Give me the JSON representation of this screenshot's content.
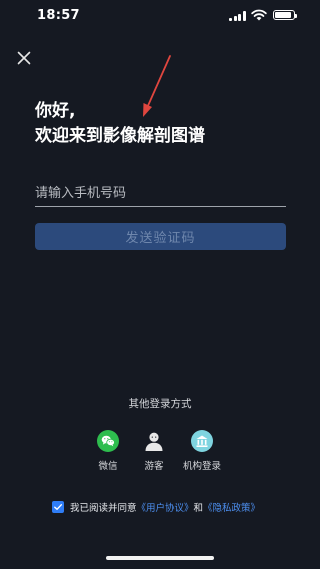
{
  "status_bar": {
    "time": "18:57",
    "signal_icon": "signal-bars-icon",
    "wifi_icon": "wifi-icon",
    "battery_icon": "battery-icon",
    "battery_level": 0.9
  },
  "header": {
    "close_icon": "close-icon"
  },
  "annotation": {
    "arrow_icon": "red-arrow-icon",
    "arrow_color": "#e0463f"
  },
  "greeting": {
    "line1": "你好,",
    "line2": "欢迎来到影像解剖图谱"
  },
  "phone_input": {
    "value": "",
    "placeholder": "请输入手机号码"
  },
  "send_code_button": {
    "label": "发送验证码",
    "background": "#2c4a7c",
    "text_color": "#6f87ad"
  },
  "other_login": {
    "title": "其他登录方式",
    "options": [
      {
        "label": "微信",
        "icon": "wechat-icon",
        "color": "#2ebd4e"
      },
      {
        "label": "游客",
        "icon": "guest-user-icon",
        "color": "#e8e8e8"
      },
      {
        "label": "机构登录",
        "icon": "institution-icon",
        "color": "#7fd4e0"
      }
    ]
  },
  "agreement": {
    "checked": true,
    "prefix": "我已阅读并同意",
    "user_agreement": "《用户协议》",
    "conjunction": "和",
    "privacy_policy": "《隐私政策》",
    "link_color": "#4d8ff0"
  },
  "colors": {
    "background": "#151922",
    "accent": "#2f7df6"
  }
}
